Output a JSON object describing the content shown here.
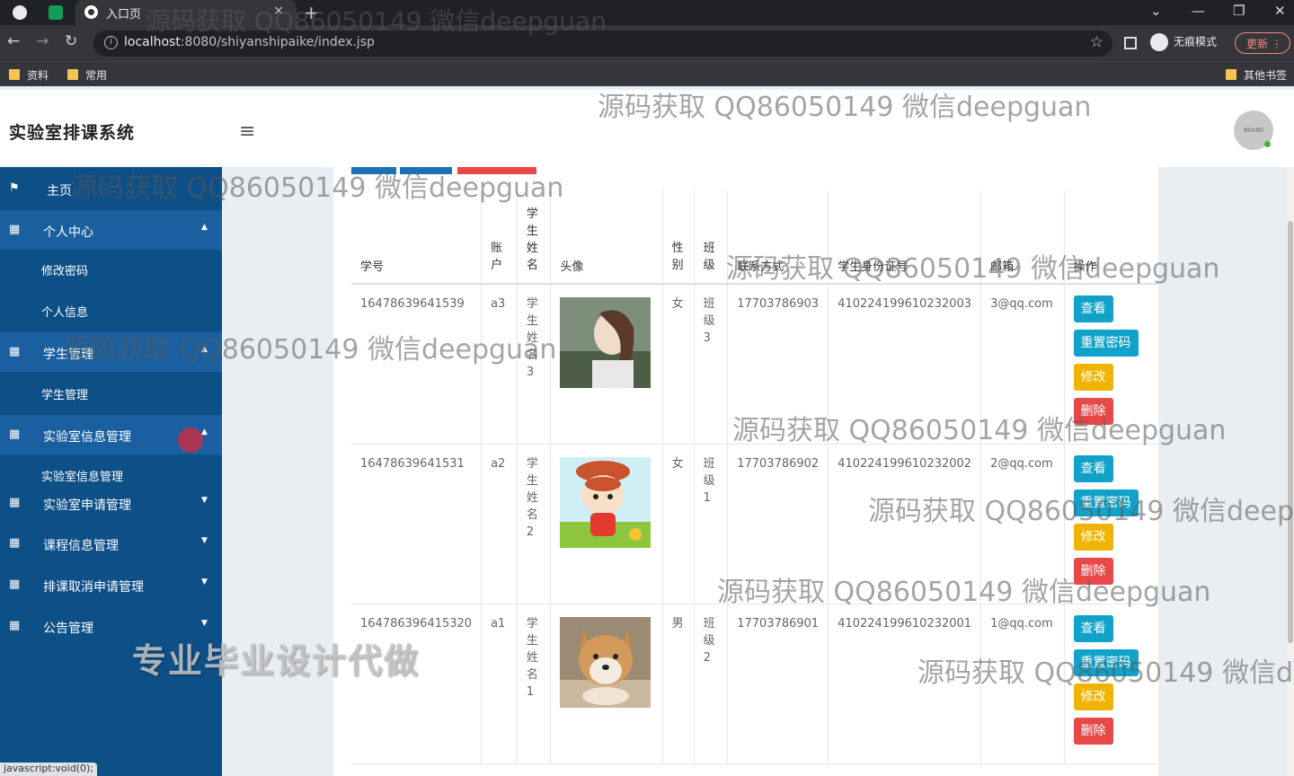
{
  "browser": {
    "tab_title": "入口页",
    "tab_close": "×",
    "new_tab": "+",
    "url_host": "localhost",
    "url_rest": ":8080/shiyanshipaike/index.jsp",
    "incognito_label": "无痕模式",
    "update_label": "更新",
    "bookmarks": [
      "资料",
      "常用"
    ],
    "other_bookmarks": "其他书签",
    "status_text": "javascript:void(0);"
  },
  "header": {
    "title": "实验室排课系统",
    "avatar_text": "80x80"
  },
  "sidebar": {
    "items": [
      {
        "label": "主页",
        "icon": "flag-icon"
      },
      {
        "label": "个人中心",
        "icon": "grid-icon",
        "sub": [
          "修改密码",
          "个人信息"
        ]
      },
      {
        "label": "学生管理",
        "icon": "grid-icon",
        "sub": [
          "学生管理"
        ]
      },
      {
        "label": "实验室信息管理",
        "icon": "grid-icon",
        "sub": [
          "实验室信息管理"
        ]
      },
      {
        "label": "实验室申请管理",
        "icon": "grid-icon"
      },
      {
        "label": "课程信息管理",
        "icon": "grid-icon"
      },
      {
        "label": "排课取消申请管理",
        "icon": "grid-icon"
      },
      {
        "label": "公告管理",
        "icon": "grid-icon"
      }
    ]
  },
  "table": {
    "headers": [
      "学号",
      "账户",
      "学生姓名",
      "头像",
      "性别",
      "班级",
      "联系方式",
      "学生身份证号",
      "邮箱",
      "操作"
    ],
    "rows": [
      {
        "id": "16478639641539",
        "account": "a3",
        "name": "学生姓名3",
        "gender": "女",
        "class": "班级3",
        "phone": "17703786903",
        "idcard": "410224199610232003",
        "email": "3@qq.com"
      },
      {
        "id": "16478639641531",
        "account": "a2",
        "name": "学生姓名2",
        "gender": "女",
        "class": "班级1",
        "phone": "17703786902",
        "idcard": "410224199610232002",
        "email": "2@qq.com"
      },
      {
        "id": "164786396415320",
        "account": "a1",
        "name": "学生姓名1",
        "gender": "男",
        "class": "班级2",
        "phone": "17703786901",
        "idcard": "410224199610232001",
        "email": "1@qq.com"
      }
    ],
    "actions": {
      "view": "查看",
      "reset": "重置密码",
      "edit": "修改",
      "delete": "删除"
    }
  },
  "watermarks": {
    "text": "源码获取 QQ86050149 微信deepguan",
    "promo": "专业毕业设计代做"
  },
  "colors": {
    "sidebar_bg": "#0d4f87",
    "sidebar_parent_bg": "#1a60a0",
    "btn_info": "#11a2c9",
    "btn_warning": "#f0b400",
    "btn_danger": "#e84848"
  }
}
